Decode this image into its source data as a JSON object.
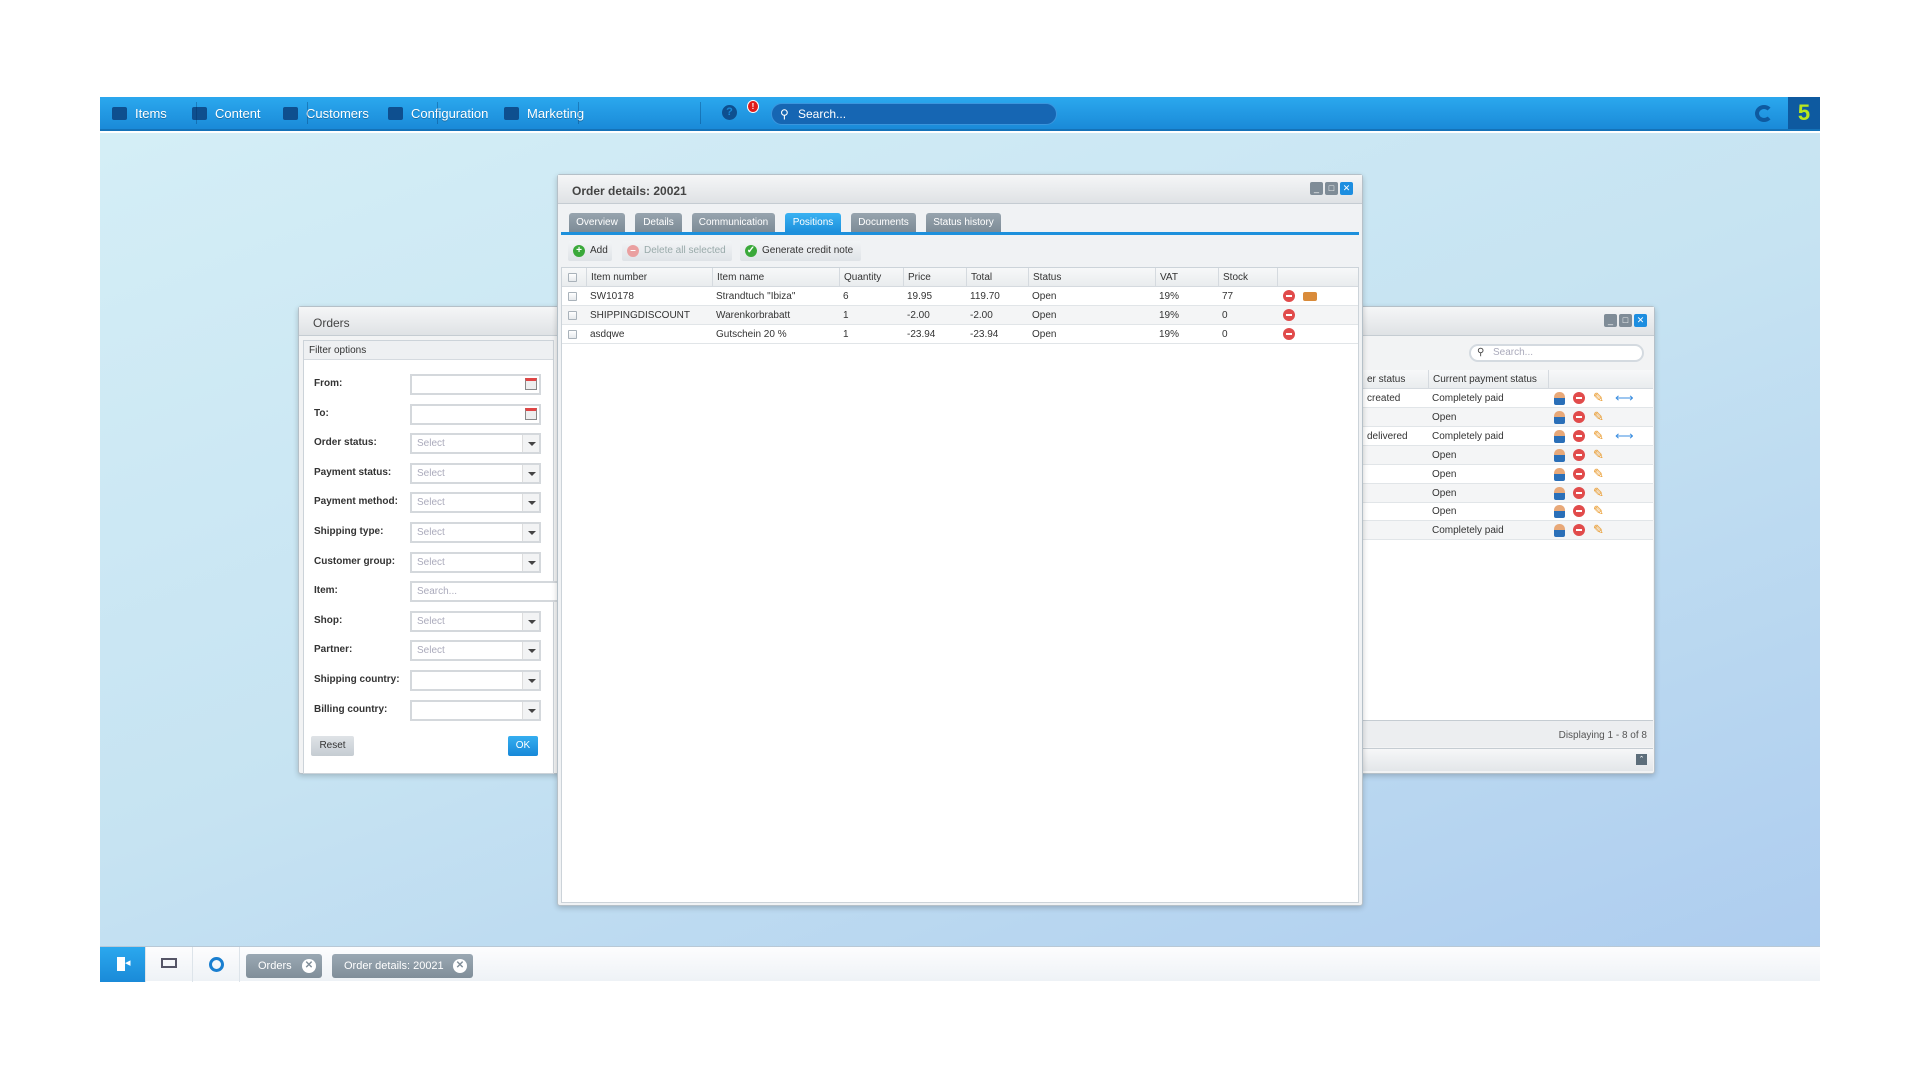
{
  "topbar": {
    "nav": [
      {
        "label": "Items",
        "icon": "inbox-icon"
      },
      {
        "label": "Content",
        "icon": "document-icon"
      },
      {
        "label": "Customers",
        "icon": "users-icon"
      },
      {
        "label": "Configuration",
        "icon": "gear-icon"
      },
      {
        "label": "Marketing",
        "icon": "pie-chart-icon"
      }
    ],
    "help_badge": "!",
    "search_placeholder": "Search...",
    "logo_text": "5"
  },
  "order_details": {
    "title": "Order details: 20021",
    "tabs": [
      "Overview",
      "Details",
      "Communication",
      "Positions",
      "Documents",
      "Status history"
    ],
    "active_tab": "Positions",
    "toolbar": {
      "add": "Add",
      "delete_all": "Delete all selected",
      "generate_credit": "Generate credit note"
    },
    "columns": [
      "Item number",
      "Item name",
      "Quantity",
      "Price",
      "Total",
      "Status",
      "VAT",
      "Stock"
    ],
    "rows": [
      [
        "SW10178",
        "Strandtuch \"Ibiza\"",
        "6",
        "19.95",
        "119.70",
        "Open",
        "19%",
        "77"
      ],
      [
        "SHIPPINGDISCOUNT",
        "Warenkorbrabatt",
        "1",
        "-2.00",
        "-2.00",
        "Open",
        "19%",
        "0"
      ],
      [
        "asdqwe",
        "Gutschein 20 %",
        "1",
        "-23.94",
        "-23.94",
        "Open",
        "19%",
        "0"
      ]
    ]
  },
  "orders": {
    "title": "Orders",
    "filter_title": "Filter options",
    "filters": [
      {
        "label": "From:",
        "type": "date",
        "value": ""
      },
      {
        "label": "To:",
        "type": "date",
        "value": ""
      },
      {
        "label": "Order status:",
        "type": "select",
        "value": "Select"
      },
      {
        "label": "Payment status:",
        "type": "select",
        "value": "Select"
      },
      {
        "label": "Payment method:",
        "type": "select",
        "value": "Select"
      },
      {
        "label": "Shipping type:",
        "type": "select",
        "value": "Select"
      },
      {
        "label": "Customer group:",
        "type": "select",
        "value": "Select"
      },
      {
        "label": "Item:",
        "type": "search",
        "value": "Search..."
      },
      {
        "label": "Shop:",
        "type": "select",
        "value": "Select"
      },
      {
        "label": "Partner:",
        "type": "select",
        "value": "Select"
      },
      {
        "label": "Shipping country:",
        "type": "select",
        "value": ""
      },
      {
        "label": "Billing country:",
        "type": "select",
        "value": ""
      }
    ],
    "reset": "Reset",
    "ok": "OK",
    "search_placeholder": "Search...",
    "columns": [
      "er status",
      "Current payment status"
    ],
    "rows": [
      [
        "created",
        "Completely paid",
        true
      ],
      [
        "",
        "Open",
        false
      ],
      [
        "delivered",
        "Completely paid",
        true
      ],
      [
        "",
        "Open",
        false
      ],
      [
        "",
        "Open",
        false
      ],
      [
        "",
        "Open",
        false
      ],
      [
        "",
        "Open",
        false
      ],
      [
        "",
        "Completely paid",
        false
      ]
    ],
    "paging": "Displaying 1 - 8 of 8"
  },
  "taskbar": {
    "tabs": [
      "Orders",
      "Order details: 20021"
    ]
  },
  "colors": {
    "accent": "#1d90dc",
    "danger": "#e14b4b"
  }
}
